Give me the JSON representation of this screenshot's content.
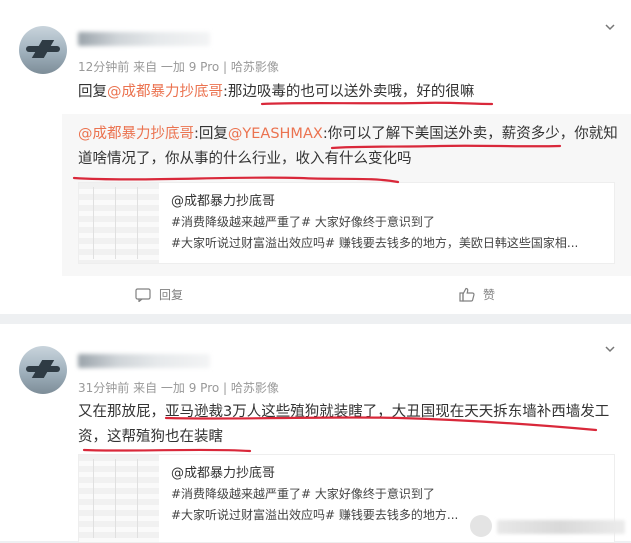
{
  "posts": [
    {
      "meta": "12分钟前  来自 一加 9 Pro | 哈苏影像",
      "reply_prefix": "回复",
      "reply_mention": "@成都暴力抄底哥",
      "reply_text": ":那边吸毒的也可以送外卖哦，好的很嘛",
      "quote": {
        "mention": "@成都暴力抄底哥",
        "mid": ":回复",
        "mention2": "@YEASHMAX",
        "text": ":你可以了解下美国送外卖，薪资多少，你就知道啥情况了，你从事的什么行业，收入有什么变化吗"
      },
      "embed": {
        "title": "@成都暴力抄底哥",
        "line1": "#消费降级越来越严重了# 大家好像终于意识到了",
        "line2": "#大家听说过财富溢出效应吗# 赚钱要去钱多的地方，美欧日韩这些国家相..."
      },
      "actions": {
        "reply": "回复",
        "like": "赞"
      }
    },
    {
      "meta": "31分钟前  来自 一加 9 Pro | 哈苏影像",
      "text": "又在那放屁，亚马逊裁3万人这些殖狗就装瞎了，大丑国现在天天拆东墙补西墙发工资，这帮殖狗也在装瞎",
      "embed": {
        "title": "@成都暴力抄底哥",
        "line1": "#消费降级越来越严重了# 大家好像终于意识到了",
        "line2": "#大家听说过财富溢出效应吗# 赚钱要去钱多的地方..."
      }
    }
  ],
  "colors": {
    "mention": "#eb7350",
    "underline": "#d9283a"
  }
}
